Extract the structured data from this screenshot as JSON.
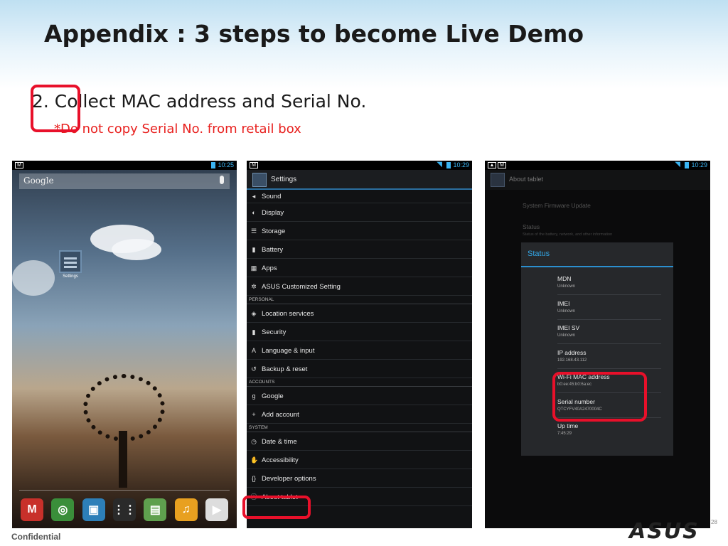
{
  "slide": {
    "title": "Appendix : 3 steps to become Live Demo",
    "step": "2. Collect MAC address and Serial No.",
    "warning": "*Do not copy Serial No. from retail box",
    "footer_left": "Confidential",
    "brand": "ASUS",
    "page_number": "28"
  },
  "colors": {
    "highlight": "#e8102a",
    "android_blue": "#33a6e6",
    "warning_red": "#e8201e"
  },
  "home_screen": {
    "status_time": "10:25",
    "search_label": "Google",
    "settings_app_label": "Settings",
    "dock_icons": [
      {
        "name": "gmail-icon",
        "glyph": "M",
        "color": "#c8302a"
      },
      {
        "name": "chrome-icon",
        "glyph": "◎",
        "color": "#3a8e3a"
      },
      {
        "name": "gallery-icon",
        "glyph": "▣",
        "color": "#2d7fb8"
      },
      {
        "name": "app-drawer-icon",
        "glyph": "⋮⋮",
        "color": "#2a2a2a"
      },
      {
        "name": "file-manager-icon",
        "glyph": "▤",
        "color": "#5fa04e"
      },
      {
        "name": "music-icon",
        "glyph": "♫",
        "color": "#e8a020"
      },
      {
        "name": "play-store-icon",
        "glyph": "▶",
        "color": "#ddd"
      }
    ]
  },
  "settings_screen": {
    "status_time": "10:29",
    "title": "Settings",
    "rows": [
      {
        "kind": "item",
        "icon": "◂",
        "label": "Sound",
        "short": true
      },
      {
        "kind": "item",
        "icon": "◐",
        "label": "Display"
      },
      {
        "kind": "item",
        "icon": "☰",
        "label": "Storage"
      },
      {
        "kind": "item",
        "icon": "▮",
        "label": "Battery"
      },
      {
        "kind": "item",
        "icon": "▦",
        "label": "Apps"
      },
      {
        "kind": "item",
        "icon": "✲",
        "label": "ASUS Customized Setting"
      },
      {
        "kind": "header",
        "label": "PERSONAL"
      },
      {
        "kind": "item",
        "icon": "◈",
        "label": "Location services"
      },
      {
        "kind": "item",
        "icon": "▮",
        "label": "Security"
      },
      {
        "kind": "item",
        "icon": "A",
        "label": "Language & input"
      },
      {
        "kind": "item",
        "icon": "↺",
        "label": "Backup & reset"
      },
      {
        "kind": "header",
        "label": "ACCOUNTS"
      },
      {
        "kind": "item",
        "icon": "g",
        "label": "Google"
      },
      {
        "kind": "item",
        "icon": "+",
        "label": "Add account"
      },
      {
        "kind": "header",
        "label": "SYSTEM"
      },
      {
        "kind": "item",
        "icon": "◷",
        "label": "Date & time"
      },
      {
        "kind": "item",
        "icon": "✋",
        "label": "Accessibility"
      },
      {
        "kind": "item",
        "icon": "{}",
        "label": "Developer options"
      },
      {
        "kind": "item",
        "icon": "ⓘ",
        "label": "About tablet"
      }
    ]
  },
  "about_screen": {
    "status_time": "10:29",
    "title": "About tablet",
    "bg_item_1": "System Firmware Update",
    "bg_item_2": "Status",
    "bg_item_2_sub": "Status of the battery, network, and other information",
    "dialog_title": "Status",
    "status_rows": [
      {
        "key": "MDN",
        "value": "Unknown"
      },
      {
        "key": "IMEI",
        "value": "Unknown"
      },
      {
        "key": "IMEI SV",
        "value": "Unknown"
      },
      {
        "key": "IP address",
        "value": "192.168.43.112"
      },
      {
        "key": "Wi-Fi MAC address",
        "value": "b0:ee:45:b0:6a:ec"
      },
      {
        "key": "Serial number",
        "value": "QTCYFV40A2470004C"
      },
      {
        "key": "Up time",
        "value": "7:45:29"
      }
    ]
  }
}
